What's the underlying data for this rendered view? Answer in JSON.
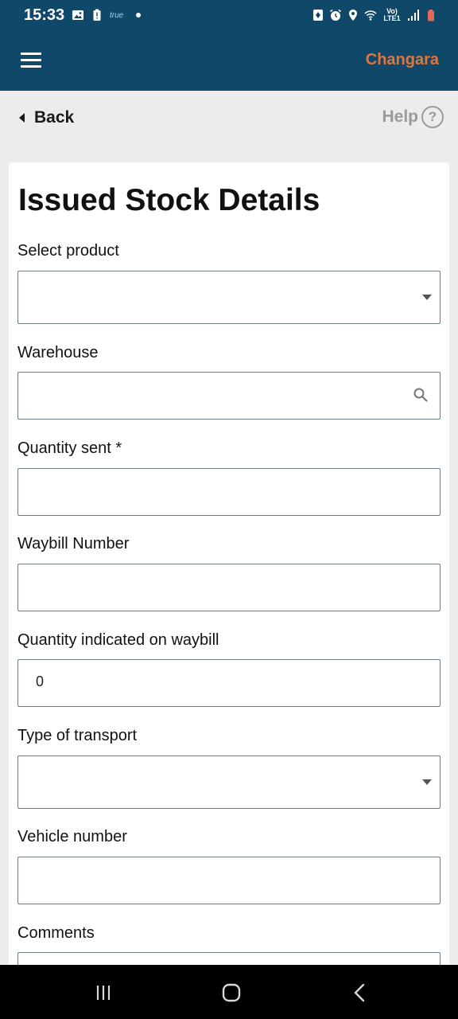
{
  "status_bar": {
    "time": "15:33",
    "carrier_badge": "true",
    "network": "Vo) LTE1"
  },
  "app_bar": {
    "brand": "Changara",
    "colors": {
      "bar": "#0f4869",
      "brand": "#e4743a"
    }
  },
  "nav": {
    "back_label": "Back",
    "help_label": "Help",
    "help_glyph": "?"
  },
  "form": {
    "title": "Issued Stock Details",
    "fields": [
      {
        "label": "Select product",
        "type": "select",
        "value": ""
      },
      {
        "label": "Warehouse",
        "type": "search",
        "value": ""
      },
      {
        "label": "Quantity sent *",
        "type": "text",
        "value": ""
      },
      {
        "label": "Waybill Number",
        "type": "text",
        "value": ""
      },
      {
        "label": "Quantity indicated on waybill",
        "type": "number",
        "value": "0"
      },
      {
        "label": "Type of transport",
        "type": "select",
        "value": ""
      },
      {
        "label": "Vehicle number",
        "type": "text",
        "value": ""
      },
      {
        "label": "Comments",
        "type": "textarea",
        "value": ""
      }
    ]
  },
  "system_nav": {
    "icons": [
      "recent-apps-icon",
      "home-icon",
      "back-icon"
    ]
  }
}
